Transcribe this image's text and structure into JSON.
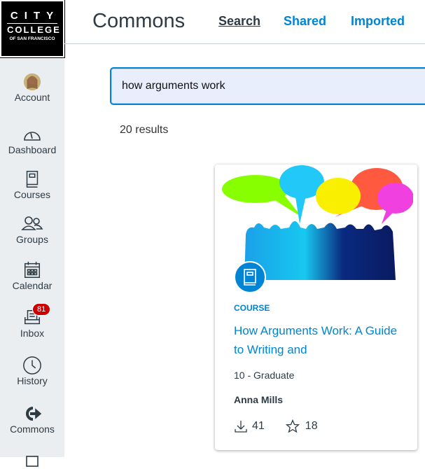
{
  "logo": {
    "line1": "CITY",
    "line2": "COLLEGE",
    "line3": "OF SAN FRANCISCO"
  },
  "sidebar": {
    "items": [
      {
        "label": "Account",
        "icon": "avatar"
      },
      {
        "label": "Dashboard",
        "icon": "dashboard-icon"
      },
      {
        "label": "Courses",
        "icon": "book-icon"
      },
      {
        "label": "Groups",
        "icon": "groups-icon"
      },
      {
        "label": "Calendar",
        "icon": "calendar-icon"
      },
      {
        "label": "Inbox",
        "icon": "inbox-icon",
        "badge": "81"
      },
      {
        "label": "History",
        "icon": "clock-icon"
      },
      {
        "label": "Commons",
        "icon": "commons-icon"
      }
    ]
  },
  "header": {
    "title": "Commons",
    "tabs": [
      {
        "label": "Search",
        "active": true
      },
      {
        "label": "Shared"
      },
      {
        "label": "Imported"
      }
    ]
  },
  "search": {
    "value": "how arguments work"
  },
  "results_count": "20 results",
  "card": {
    "kind": "COURSE",
    "title": "How Arguments Work: A Guide to Writing and",
    "grade": "10 - Graduate",
    "author": "Anna Mills",
    "downloads": "41",
    "favorites": "18"
  },
  "colors": {
    "accent": "#0084d4",
    "badge": "#cc0000",
    "sidebar": "#ebeef0"
  }
}
